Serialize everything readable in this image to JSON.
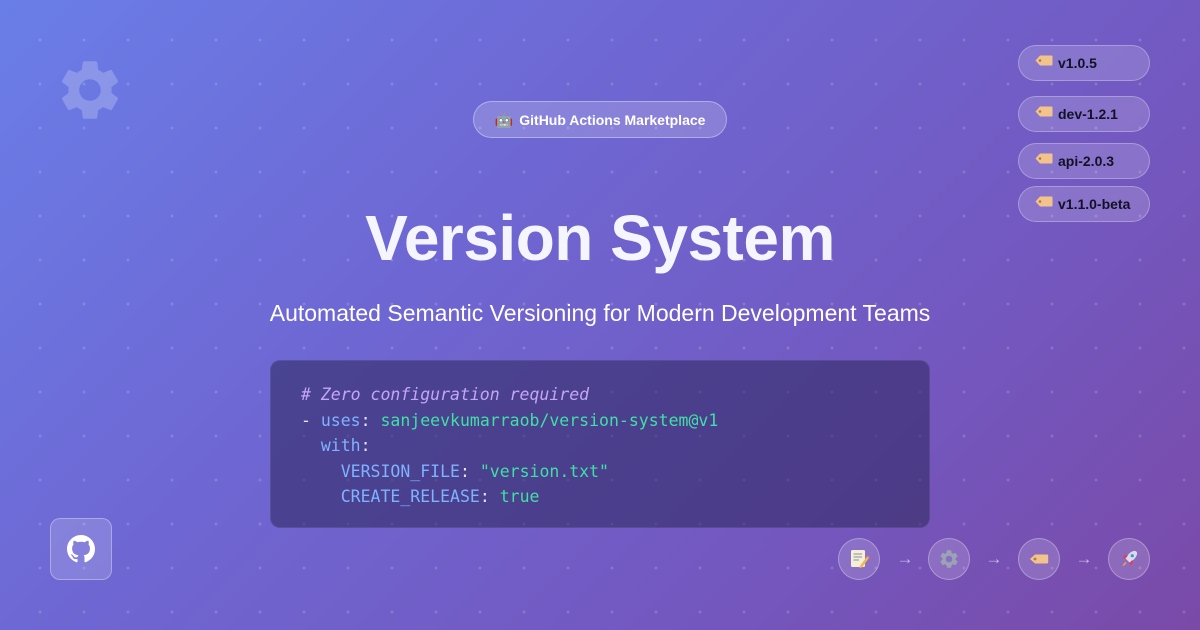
{
  "badge": {
    "emoji": "🤖",
    "label": "GitHub Actions Marketplace"
  },
  "title": "Version System",
  "subtitle": "Automated Semantic Versioning for Modern Development Teams",
  "code": {
    "comment": "# Zero configuration required",
    "dash": "-",
    "uses_key": "uses",
    "uses_value": "sanjeevkumarraob/version-system@v1",
    "with_key": "with",
    "version_file_key": "VERSION_FILE",
    "version_file_value": "\"version.txt\"",
    "create_release_key": "CREATE_RELEASE",
    "create_release_value": "true",
    "colon": ":"
  },
  "version_tags": [
    {
      "label": "v1.0.5",
      "icon": "tag-icon"
    },
    {
      "label": "dev-1.2.1",
      "icon": "tag-icon"
    },
    {
      "label": "api-2.0.3",
      "icon": "tag-icon"
    },
    {
      "label": "v1.1.0-beta",
      "icon": "tag-icon"
    }
  ],
  "github_button": {
    "icon": "github-icon"
  },
  "workflow": {
    "steps": [
      {
        "icon": "memo-icon"
      },
      {
        "icon": "gear-icon"
      },
      {
        "icon": "tag-icon"
      },
      {
        "icon": "rocket-icon"
      }
    ],
    "arrow": "→"
  },
  "colors": {
    "comment": "#c3a6f4",
    "key": "#7fb2ff",
    "string": "#40e0a5",
    "tag": "#f2c48c"
  }
}
